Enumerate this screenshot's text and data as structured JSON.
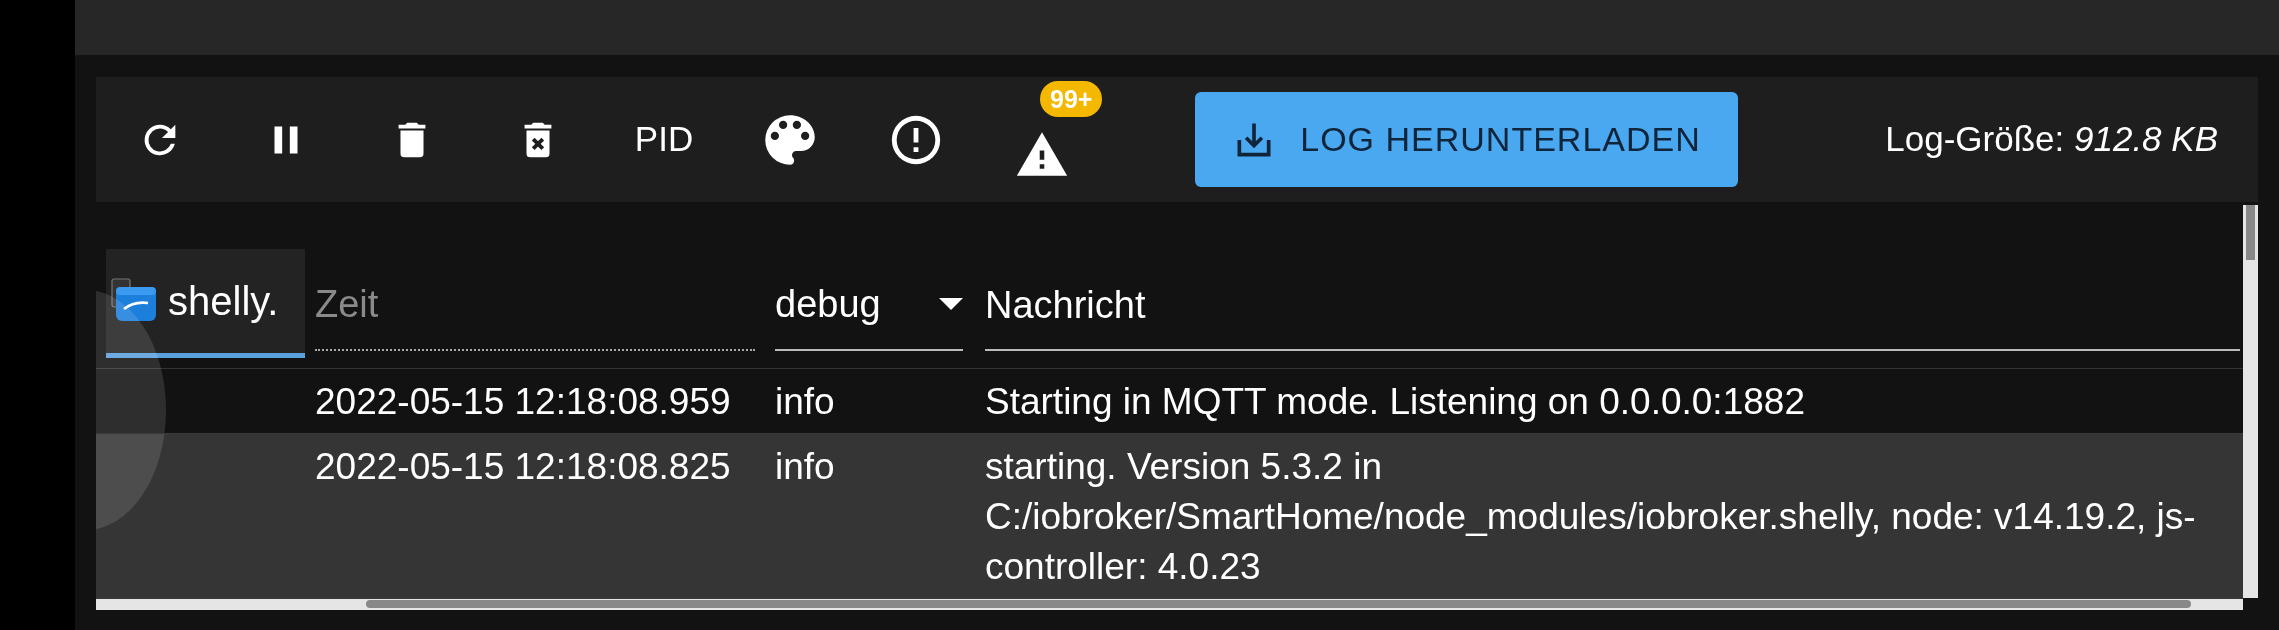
{
  "toolbar": {
    "pid_button": "PID",
    "warning_badge": "99+",
    "download_button": "LOG HERUNTERLADEN",
    "log_size": "Log-Größe: *912.8 KB*"
  },
  "log_table": {
    "source_tab": {
      "label": "shelly.",
      "selected": true
    },
    "time_filter": {
      "placeholder": "Zeit"
    },
    "level_filter": {
      "value": "debug"
    },
    "message_header": "Nachricht",
    "rows": [
      {
        "time": "2022-05-15 12:18:08.959",
        "level": "info",
        "message": "Starting in MQTT mode. Listening on 0.0.0.0:1882",
        "selected": false
      },
      {
        "time": "2022-05-15 12:18:08.825",
        "level": "info",
        "message": "starting. Version 5.3.2 in C:/iobroker/SmartHome/node_modules/iobroker.shelly, node: v14.19.2, js-controller: 4.0.23",
        "selected": true
      }
    ]
  }
}
